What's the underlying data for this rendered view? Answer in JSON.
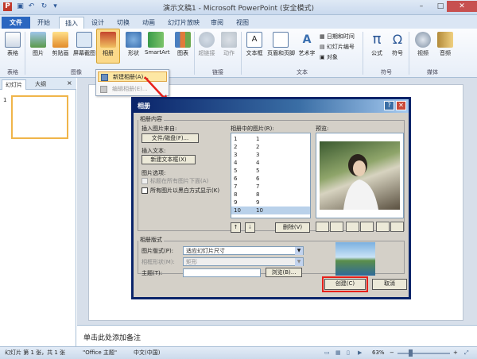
{
  "window": {
    "title": "演示文稿1 - Microsoft PowerPoint (安全模式)",
    "min": "–",
    "max": "□",
    "close": "✕"
  },
  "tabs": [
    "文件",
    "开始",
    "插入",
    "设计",
    "切换",
    "动画",
    "幻灯片放映",
    "审阅",
    "视图"
  ],
  "ribbon": {
    "buttons": {
      "table": "表格",
      "picture": "图片",
      "clipart": "剪贴画",
      "screenshot": "屏幕截图",
      "album": "相册",
      "shapes": "形状",
      "smartart": "SmartArt",
      "chart": "图表",
      "hyperlink": "超链接",
      "action": "动作",
      "textbox": "文本框",
      "header_footer": "页眉和页脚",
      "wordart": "艺术字",
      "datetime": "日期和时间",
      "slide_number": "幻灯片编号",
      "object": "对象",
      "equation": "公式",
      "symbol": "符号",
      "video": "视频",
      "audio": "音频"
    },
    "groups": {
      "tables": "表格",
      "images": "图像",
      "links": "链接",
      "text": "文本",
      "symbols": "符号",
      "media": "媒体"
    }
  },
  "album_menu": {
    "new_album": "新建相册(A)...",
    "edit_album": "编辑相册(E)..."
  },
  "left_pane": {
    "tab_slides": "幻灯片",
    "tab_outline": "大纲",
    "close": "×",
    "slide_number": "1"
  },
  "notes_placeholder": "单击此处添加备注",
  "status": {
    "slide_info": "幻灯片 第 1 张，共 1 张",
    "theme": "\"Office 主题\"",
    "language": "中文(中国)",
    "zoom": "63%",
    "zoom_minus": "−",
    "zoom_plus": "+"
  },
  "dialog": {
    "title": "相册",
    "help": "?",
    "close": "✕",
    "section_content": "相册内容",
    "insert_picture_from": "插入图片来自:",
    "file_disk_button": "文件/磁盘(F)...",
    "insert_text": "插入文本:",
    "new_textbox_button": "新建文本框(X)",
    "picture_options": "图片选项:",
    "option_captions": "标题在所有图片下面(A)",
    "option_bw": "所有图片以黑白方式显示(K)",
    "pictures_in_album": "相册中的图片(R):",
    "preview": "预览:",
    "list": [
      {
        "n": "1",
        "v": "1"
      },
      {
        "n": "2",
        "v": "2"
      },
      {
        "n": "3",
        "v": "3"
      },
      {
        "n": "4",
        "v": "4"
      },
      {
        "n": "5",
        "v": "5"
      },
      {
        "n": "6",
        "v": "6"
      },
      {
        "n": "7",
        "v": "7"
      },
      {
        "n": "8",
        "v": "8"
      },
      {
        "n": "9",
        "v": "9"
      },
      {
        "n": "10",
        "v": "10"
      }
    ],
    "selected_index": 9,
    "move_up": "↑",
    "move_down": "↓",
    "remove_button": "删除(V)",
    "section_layout": "相册版式",
    "picture_layout_label": "图片版式(P):",
    "picture_layout_value": "适应幻灯片尺寸",
    "frame_shape_label": "相框形状(M):",
    "frame_shape_value": "矩形",
    "theme_label": "主题(T):",
    "theme_value": "",
    "browse_button": "浏览(B)...",
    "create_button": "创建(C)",
    "cancel_button": "取消"
  },
  "colors": {
    "accent_red": "#e8201a",
    "file_tab": "#2a66c0",
    "dialog_title": "#0a246a"
  }
}
